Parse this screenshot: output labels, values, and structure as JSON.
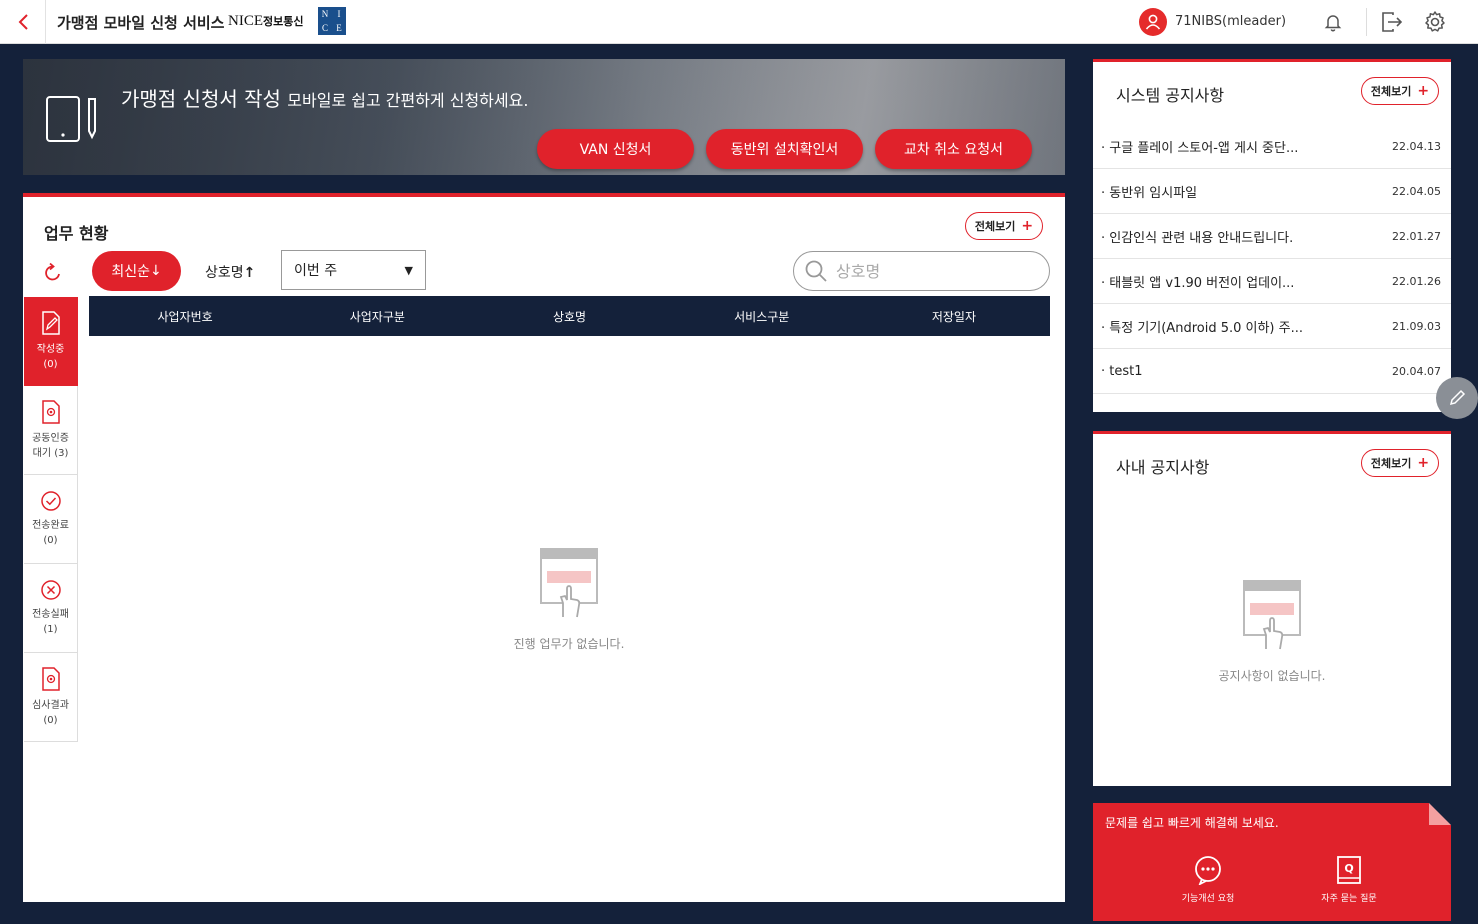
{
  "header": {
    "title": "가맹점 모바일 신청 서비스",
    "brand_text": "NICE",
    "brand_sub": "정보통신",
    "brand_logo_letters": [
      "N",
      "I",
      "C",
      "E"
    ],
    "user": "71NIBS(mleader)"
  },
  "banner": {
    "title": "가맹점 신청서 작성",
    "subtitle": "모바일로 쉽고 간편하게 신청하세요.",
    "buttons": [
      "VAN 신청서",
      "동반위 설치확인서",
      "교차 취소 요청서"
    ]
  },
  "work": {
    "title": "업무 현황",
    "view_all": "전체보기",
    "sort_latest": "최신순",
    "sort_name": "상호명",
    "period": "이번 주",
    "search_placeholder": "상호명",
    "columns": [
      "사업자번호",
      "사업자구분",
      "상호명",
      "서비스구분",
      "저장일자"
    ],
    "tabs": [
      {
        "label": "작성중",
        "count": "(0)"
      },
      {
        "label": "공동인증",
        "label2": "대기 (3)"
      },
      {
        "label": "전송완료",
        "count": "(0)"
      },
      {
        "label": "전송실패",
        "count": "(1)"
      },
      {
        "label": "심사결과",
        "count": "(0)"
      }
    ],
    "empty_text": "진행 업무가 없습니다."
  },
  "system_notice": {
    "title": "시스템 공지사항",
    "view_all": "전체보기",
    "items": [
      {
        "text": "· 구글 플레이 스토어-앱 게시 중단...",
        "date": "22.04.13"
      },
      {
        "text": "· 동반위 임시파일",
        "date": "22.04.05"
      },
      {
        "text": "· 인감인식 관련 내용 안내드립니다.",
        "date": "22.01.27"
      },
      {
        "text": "· 태블릿 앱 v1.90 버전이 업데이...",
        "date": "22.01.26"
      },
      {
        "text": "· 특정 기기(Android 5.0 이하) 주...",
        "date": "21.09.03"
      },
      {
        "text": "· test1",
        "date": "20.04.07"
      }
    ]
  },
  "internal_notice": {
    "title": "사내 공지사항",
    "view_all": "전체보기",
    "empty_text": "공지사항이 없습니다."
  },
  "help": {
    "title": "문제를 쉽고 빠르게 해결해 보세요.",
    "improve": "기능개선 요청",
    "faq": "자주 묻는 질문"
  },
  "colors": {
    "accent": "#e0222b",
    "navy": "#14213a"
  }
}
